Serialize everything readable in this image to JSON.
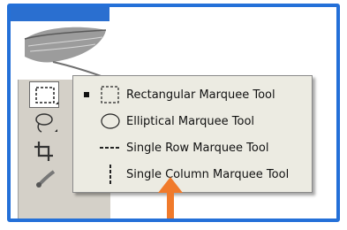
{
  "accent_color": "#2470d8",
  "arrow_color": "#f07a2b",
  "tools": [
    {
      "name": "marquee-tool-icon",
      "selected": true
    },
    {
      "name": "lasso-tool-icon",
      "selected": false
    },
    {
      "name": "crop-tool-icon",
      "selected": false
    },
    {
      "name": "brush-tool-icon",
      "selected": false
    }
  ],
  "menu": {
    "items": [
      {
        "label": "Rectangular Marquee Tool",
        "icon": "rectangular-marquee-icon",
        "active": true
      },
      {
        "label": "Elliptical Marquee Tool",
        "icon": "elliptical-marquee-icon",
        "active": false
      },
      {
        "label": "Single Row Marquee Tool",
        "icon": "single-row-marquee-icon",
        "active": false
      },
      {
        "label": "Single Column Marquee Tool",
        "icon": "single-column-marquee-icon",
        "active": false
      }
    ]
  }
}
